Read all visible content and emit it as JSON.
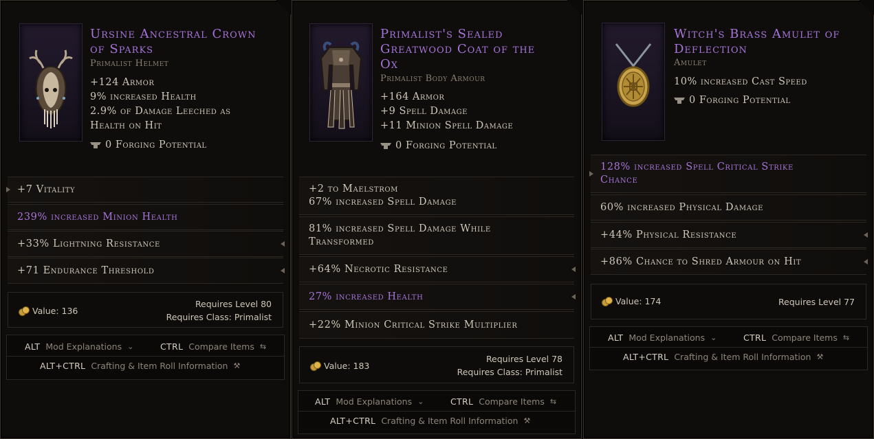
{
  "items": [
    {
      "title_lines": [
        "Ursine Ancestral Crown",
        "of Sparks"
      ],
      "type": "Primalist Helmet",
      "icon": "horned-helmet-icon",
      "implicits": [
        "+124 Armor",
        "9% increased Health",
        "2.9% of Damage Leeched as",
        "Health on Hit"
      ],
      "forging": "0 Forging Potential",
      "affixes": [
        {
          "lines": [
            "+7 Vitality"
          ],
          "tier": "normal"
        },
        {
          "lines": [
            "239% increased Minion Health"
          ],
          "tier": "exalted"
        },
        {
          "lines": [
            "+33% Lightning Resistance"
          ],
          "tier": "normal"
        },
        {
          "lines": [
            "+71 Endurance Threshold"
          ],
          "tier": "normal"
        }
      ],
      "value_label": "Value: 136",
      "requires_level": "Requires Level 80",
      "requires_class": "Requires Class: Primalist"
    },
    {
      "title_lines": [
        "Primalist's Sealed",
        "Greatwood Coat of the",
        "Ox"
      ],
      "type": "Primalist Body Armour",
      "icon": "body-armour-icon",
      "implicits": [
        "+164 Armor",
        "+9 Spell Damage",
        "+11 Minion Spell Damage"
      ],
      "forging": "0 Forging Potential",
      "affixes": [
        {
          "lines": [
            "+2 to Maelstrom",
            "67% increased Spell Damage"
          ],
          "tier": "normal"
        },
        {
          "lines": [
            "81% increased Spell Damage While",
            "Transformed"
          ],
          "tier": "normal"
        },
        {
          "lines": [
            "+64% Necrotic Resistance"
          ],
          "tier": "normal"
        },
        {
          "lines": [
            "27% increased Health"
          ],
          "tier": "exalted"
        },
        {
          "lines": [
            "+22% Minion Critical Strike Multiplier"
          ],
          "tier": "normal"
        }
      ],
      "value_label": "Value: 183",
      "requires_level": "Requires Level 78",
      "requires_class": "Requires Class: Primalist"
    },
    {
      "title_lines": [
        "Witch's Brass Amulet of",
        "Deflection"
      ],
      "type": "Amulet",
      "icon": "amulet-icon",
      "implicits": [
        "10% increased Cast Speed"
      ],
      "forging": "0 Forging Potential",
      "affixes": [
        {
          "lines": [
            "128% increased Spell Critical Strike",
            "Chance"
          ],
          "tier": "exalted"
        },
        {
          "lines": [
            "60% increased Physical Damage"
          ],
          "tier": "normal"
        },
        {
          "lines": [
            "+44% Physical Resistance"
          ],
          "tier": "normal"
        },
        {
          "lines": [
            "+86% Chance to Shred Armour on Hit"
          ],
          "tier": "normal"
        }
      ],
      "value_label": "Value: 174",
      "requires_level": "Requires Level 77",
      "requires_class": ""
    }
  ],
  "keybinds": {
    "alt": "ALT",
    "mod_explanations": "Mod Explanations",
    "ctrl": "CTRL",
    "compare_items": "Compare Items",
    "alt_ctrl": "ALT+CTRL",
    "crafting_info": "Crafting & Item Roll Information"
  },
  "colors": {
    "exalted": "#a774d9",
    "normal": "#cfc7b8",
    "title": "#a774d9"
  }
}
